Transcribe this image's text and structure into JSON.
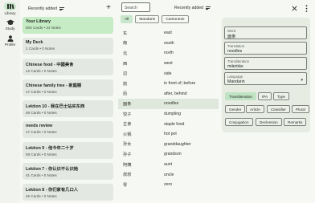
{
  "nav": {
    "items": [
      {
        "label": "Library",
        "icon": "library-icon"
      },
      {
        "label": "Study",
        "icon": "school-icon"
      },
      {
        "label": "Profile",
        "icon": "person-icon"
      }
    ]
  },
  "library": {
    "sort_label": "Recently added",
    "add_glyph": "+",
    "cards": [
      {
        "title": "Your Library",
        "sub": "506 Cards • 24 Notes"
      },
      {
        "title": "My Deck",
        "sub": "1 Cards • 0 Notes"
      },
      {
        "title": "Chinese food - 中國美食",
        "sub": "12 Cards • 0 Notes"
      },
      {
        "title": "Chinese family tree - 家庭樹",
        "sub": "17 Cards • 0 Notes"
      },
      {
        "title": "Lektion 10 - 我在巴士站买东西",
        "sub": "46 Cards • 0 Notes"
      },
      {
        "title": "needs review",
        "sub": "17 Cards • 0 Notes"
      },
      {
        "title": "Lektion 9 - 他今年二十岁",
        "sub": "59 Cards • 0 Notes"
      },
      {
        "title": "Lektion 7 - 你认识不认识她",
        "sub": "41 Cards • 0 Notes"
      },
      {
        "title": "Lektion 8 - 你们家有几口人",
        "sub": "45 Cards • 0 Notes"
      }
    ]
  },
  "wordlist": {
    "search_placeholder": "Search",
    "sort_label": "Recently added",
    "filters": [
      "All",
      "Mandarin",
      "Cantonese"
    ],
    "words": [
      {
        "zh": "东",
        "en": "east"
      },
      {
        "zh": "南",
        "en": "south"
      },
      {
        "zh": "北",
        "en": "north"
      },
      {
        "zh": "西",
        "en": "west"
      },
      {
        "zh": "边",
        "en": "side"
      },
      {
        "zh": "前",
        "en": "in front of; before"
      },
      {
        "zh": "后",
        "en": "after, behind"
      },
      {
        "zh": "面条",
        "en": "noodles"
      },
      {
        "zh": "饺子",
        "en": "dumpling"
      },
      {
        "zh": "主食",
        "en": "staple food"
      },
      {
        "zh": "火锅",
        "en": "hot pot"
      },
      {
        "zh": "孙女",
        "en": "granddaughter"
      },
      {
        "zh": "孙子",
        "en": "grandson"
      },
      {
        "zh": "阿姨",
        "en": "aunt"
      },
      {
        "zh": "叔叔",
        "en": "uncle"
      },
      {
        "zh": "零",
        "en": "zero"
      }
    ]
  },
  "detail": {
    "word_label": "Word",
    "word_value": "面条",
    "translation_label": "Translation",
    "translation_value": "noodles",
    "transliteration_label": "Transliteration",
    "transliteration_value": "miàntiáo",
    "language_label": "Language",
    "language_value": "Mandarin",
    "tags_row1": [
      "Transliteration",
      "IPA",
      "Type"
    ],
    "tags_row2": [
      "Gender",
      "Article",
      "Classifier",
      "Plural"
    ],
    "tags_row3": [
      "Conjugation",
      "Declension",
      "Remarks"
    ]
  },
  "colors": {
    "accent": "#c8e6cc",
    "selected_card": "#c5ecc5",
    "background": "#f6f8f4"
  }
}
